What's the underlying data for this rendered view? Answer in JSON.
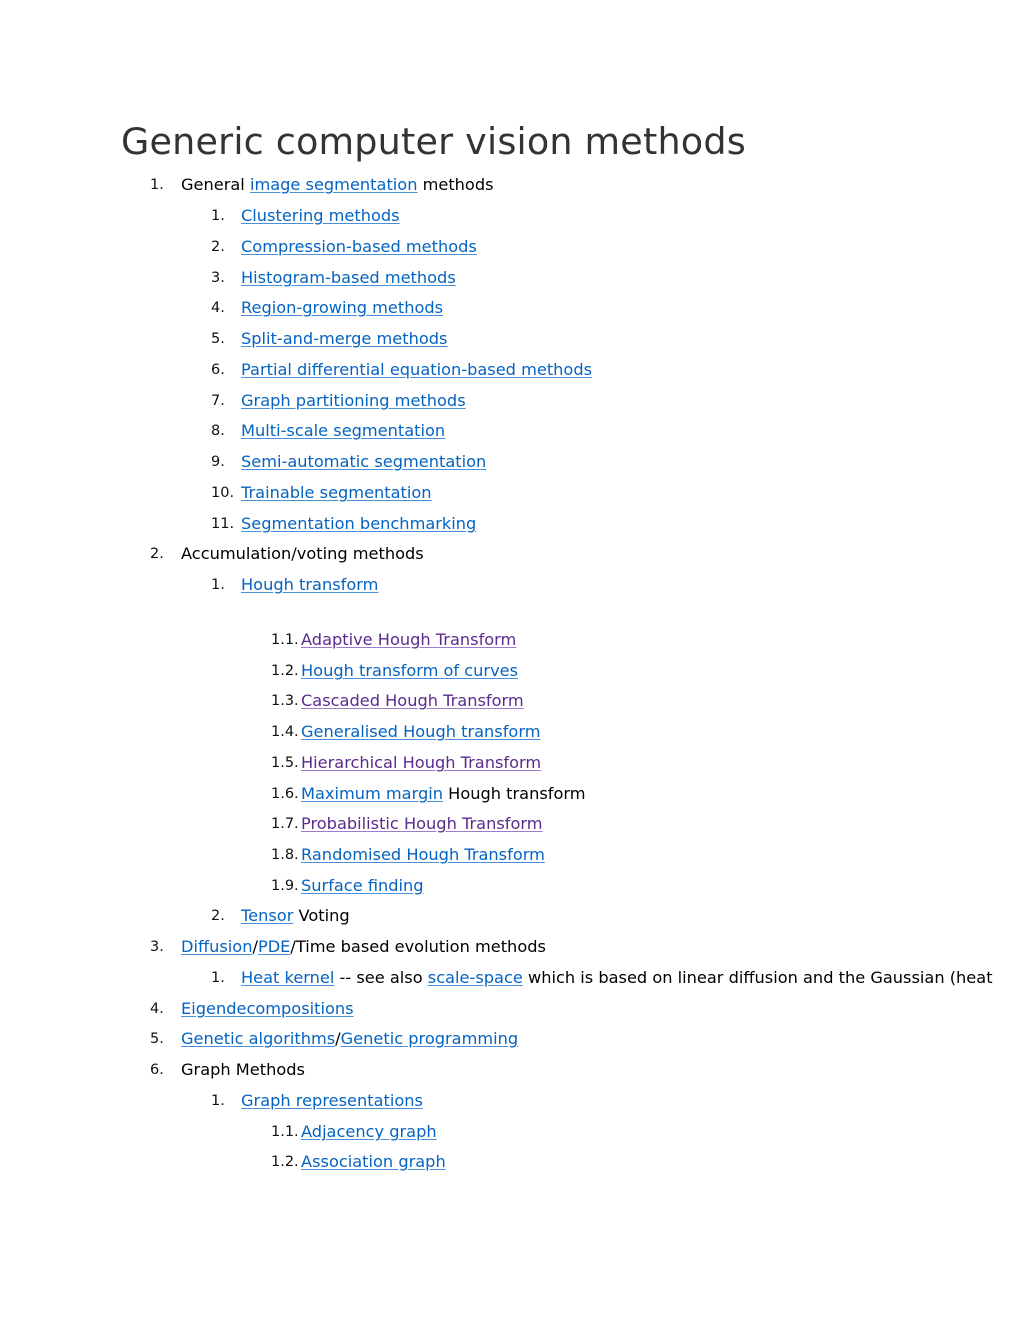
{
  "title": "Generic computer vision methods",
  "colors": {
    "link": "#0563c1",
    "visited_link": "#5b2a8e",
    "title": "#333333",
    "text": "#000000"
  },
  "items": {
    "i1": {
      "num": "1.",
      "pre": "General ",
      "link": "image segmentation",
      "post": " methods"
    },
    "i1_1": {
      "num": "1.",
      "link": "Clustering methods"
    },
    "i1_2": {
      "num": "2.",
      "link": "Compression-based methods"
    },
    "i1_3": {
      "num": "3.",
      "link": "Histogram-based methods"
    },
    "i1_4": {
      "num": "4.",
      "link": "Region-growing methods"
    },
    "i1_5": {
      "num": "5.",
      "link": "Split-and-merge methods"
    },
    "i1_6": {
      "num": "6.",
      "link": "Partial differential equation-based methods"
    },
    "i1_7": {
      "num": "7.",
      "link": "Graph partitioning methods"
    },
    "i1_8": {
      "num": "8.",
      "link": "Multi-scale segmentation"
    },
    "i1_9": {
      "num": "9.",
      "link": "Semi-automatic segmentation"
    },
    "i1_10": {
      "num": "10.",
      "link": "Trainable segmentation"
    },
    "i1_11": {
      "num": "11.",
      "link": "Segmentation benchmarking"
    },
    "i2": {
      "num": "2.",
      "text": "Accumulation/voting methods"
    },
    "i2_1": {
      "num": "1.",
      "link": "Hough transform"
    },
    "i2_1_1": {
      "num": "1.1.",
      "link": "Adaptive Hough Transform",
      "visited": true
    },
    "i2_1_2": {
      "num": "1.2.",
      "link": "Hough transform of curves",
      "visited": false
    },
    "i2_1_3": {
      "num": "1.3.",
      "link": "Cascaded Hough Transform",
      "visited": true
    },
    "i2_1_4": {
      "num": "1.4.",
      "link": "Generalised Hough transform",
      "visited": false
    },
    "i2_1_5": {
      "num": "1.5.",
      "link": "Hierarchical Hough Transform",
      "visited": true
    },
    "i2_1_6": {
      "num": "1.6.",
      "link": "Maximum margin",
      "post": " Hough transform"
    },
    "i2_1_7": {
      "num": "1.7.",
      "link": "Probabilistic Hough Transform",
      "visited": true
    },
    "i2_1_8": {
      "num": "1.8.",
      "link": "Randomised Hough Transform",
      "visited": false
    },
    "i2_1_9": {
      "num": "1.9.",
      "link": "Surface finding",
      "visited": false
    },
    "i2_2": {
      "num": "2.",
      "link": "Tensor",
      "post": " Voting"
    },
    "i3": {
      "num": "3.",
      "link1": "Diffusion",
      "sep1": "/",
      "link2": "PDE",
      "post": "/Time based evolution methods"
    },
    "i3_1": {
      "num": "1.",
      "link1": "Heat kernel",
      "mid": " -- see also ",
      "link2": "scale-space",
      "post": " which is based on linear diffusion and the Gaussian (heat"
    },
    "i4": {
      "num": "4.",
      "link": "Eigendecompositions"
    },
    "i5": {
      "num": "5.",
      "link1": "Genetic algorithms",
      "sep": "/",
      "link2": "Genetic programming"
    },
    "i6": {
      "num": "6.",
      "text": "Graph Methods"
    },
    "i6_1": {
      "num": "1.",
      "link": "Graph representations"
    },
    "i6_1_1": {
      "num": "1.1.",
      "link": "Adjacency graph"
    },
    "i6_1_2": {
      "num": "1.2.",
      "link": "Association graph"
    }
  }
}
